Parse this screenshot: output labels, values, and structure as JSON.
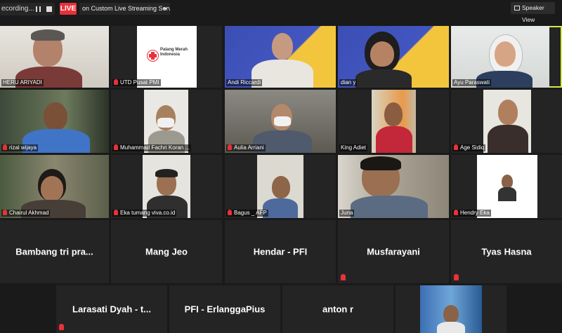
{
  "topbar": {
    "recording_label": "ecording...",
    "live_label": "LIVE",
    "stream_label": "on Custom Live Streaming Service",
    "speaker_view_label": "Speaker View"
  },
  "video_tiles": [
    {
      "name": "HERU ARIYADI"
    },
    {
      "name": "UTD Pusat PMI",
      "logo_text": "Palang Merah Indonesia"
    },
    {
      "name": "Andi Riccardi"
    },
    {
      "name": "dian y"
    },
    {
      "name": "Ayu Paraswati"
    },
    {
      "name": "rizal wijaya"
    },
    {
      "name": "Muhammad Fachri Koran ..."
    },
    {
      "name": "Aulia Arriani"
    },
    {
      "name": "King Adiet"
    },
    {
      "name": "Age Sidiq"
    },
    {
      "name": "Chairul Akhmad"
    },
    {
      "name": "Eka tumang viva.co.id"
    },
    {
      "name": "Bagus _ AFP"
    },
    {
      "name": "Juna"
    },
    {
      "name": "Hendry Eka"
    }
  ],
  "name_tiles": [
    {
      "name": "Bambang tri pra..."
    },
    {
      "name": "Mang Jeo"
    },
    {
      "name": "Hendar - PFI"
    },
    {
      "name": "Musfarayani"
    },
    {
      "name": "Tyas Hasna"
    },
    {
      "name": "Larasati Dyah - t..."
    },
    {
      "name": "PFI - ErlanggaPius"
    },
    {
      "name": "anton r"
    }
  ],
  "colors": {
    "live": "#e8313a",
    "active_speaker_border": "#d8e84a",
    "mute": "#e8313a"
  }
}
